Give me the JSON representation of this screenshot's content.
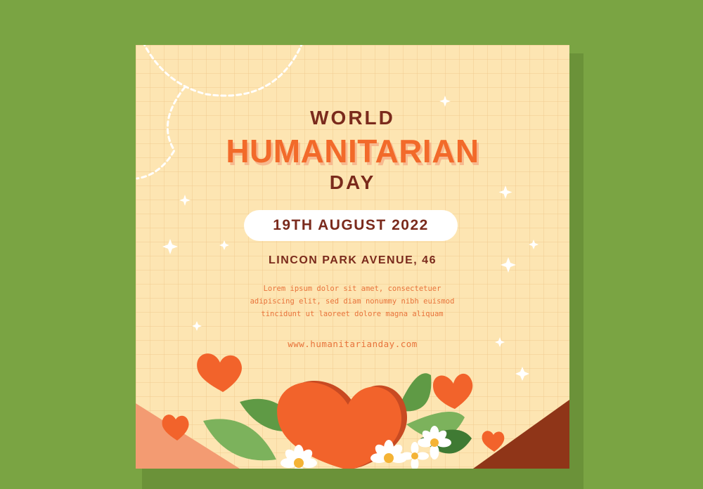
{
  "poster": {
    "title_line1": "WORLD",
    "title_line2": "HUMANITARIAN",
    "title_line3": "DAY",
    "date": "19TH AUGUST 2022",
    "address": "LINCON PARK AVENUE, 46",
    "body_lines": [
      "Lorem ipsum dolor sit amet, consectetuer",
      "adipiscing elit, sed diam nonummy nibh euismod",
      "tincidunt ut laoreet dolore magna aliquam"
    ],
    "website": "www.humanitarianday.com"
  },
  "colors": {
    "background": "#7aa443",
    "poster": "#fde5b2",
    "accent_orange": "#f26a2a",
    "dark_brown": "#7a2a1c",
    "leaf_green": "#5f9a45"
  },
  "icons": [
    "heart-icon",
    "leaf-icon",
    "daisy-icon",
    "sparkle-icon"
  ]
}
